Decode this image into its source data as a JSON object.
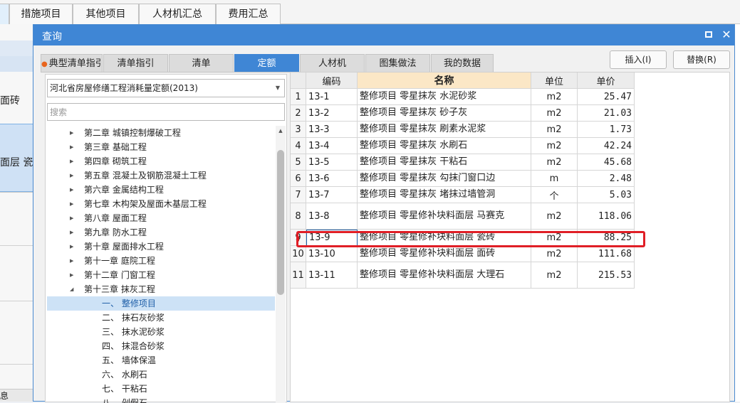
{
  "background": {
    "tabs": [
      {
        "label": ""
      },
      {
        "label": "措施项目"
      },
      {
        "label": "其他项目"
      },
      {
        "label": "人材机汇总"
      },
      {
        "label": "费用汇总"
      }
    ],
    "left_texts": [
      "面砖",
      "面层 瓷"
    ],
    "bottom_tab": "息"
  },
  "dialog": {
    "title": "查询",
    "tabs": [
      {
        "label": "典型清单指引"
      },
      {
        "label": "清单指引"
      },
      {
        "label": "清单"
      },
      {
        "label": "定额"
      },
      {
        "label": "人材机"
      },
      {
        "label": "图集做法"
      },
      {
        "label": "我的数据"
      }
    ],
    "active_tab": "定额",
    "insert_label": "插入(I)",
    "replace_label": "替换(R)",
    "quota_library": "河北省房屋修缮工程消耗量定额(2013)",
    "search_placeholder": "搜索",
    "tree": [
      {
        "label": "第二章 城镇控制爆破工程",
        "expand": "collapsed"
      },
      {
        "label": "第三章 基础工程",
        "expand": "collapsed"
      },
      {
        "label": "第四章 砌筑工程",
        "expand": "collapsed"
      },
      {
        "label": "第五章 混凝土及钢筋混凝土工程",
        "expand": "collapsed"
      },
      {
        "label": "第六章 金属结构工程",
        "expand": "collapsed"
      },
      {
        "label": "第七章 木构架及屋面木基层工程",
        "expand": "collapsed"
      },
      {
        "label": "第八章 屋面工程",
        "expand": "collapsed"
      },
      {
        "label": "第九章 防水工程",
        "expand": "collapsed"
      },
      {
        "label": "第十章 屋面排水工程",
        "expand": "collapsed"
      },
      {
        "label": "第十一章 庭院工程",
        "expand": "collapsed"
      },
      {
        "label": "第十二章 门窗工程",
        "expand": "collapsed"
      },
      {
        "label": "第十三章 抹灰工程",
        "expand": "expanded"
      },
      {
        "label": "一、 整修项目",
        "expand": "none",
        "selected": true
      },
      {
        "label": "二、 抹石灰砂浆",
        "expand": "none"
      },
      {
        "label": "三、 抹水泥砂浆",
        "expand": "none"
      },
      {
        "label": "四、 抹混合砂浆",
        "expand": "none"
      },
      {
        "label": "五、 墙体保温",
        "expand": "none"
      },
      {
        "label": "六、 水刷石",
        "expand": "none"
      },
      {
        "label": "七、 干粘石",
        "expand": "none"
      },
      {
        "label": "八、 剁假石",
        "expand": "none"
      }
    ],
    "grid": {
      "headers": {
        "index": "",
        "code": "编码",
        "name": "名称",
        "unit": "单位",
        "price": "单价"
      },
      "rows": [
        {
          "index": "1",
          "code": "13-1",
          "name": "整修项目 零星抹灰 水泥砂浆",
          "unit": "m2",
          "price": "25.47"
        },
        {
          "index": "2",
          "code": "13-2",
          "name": "整修项目 零星抹灰 砂子灰",
          "unit": "m2",
          "price": "21.03"
        },
        {
          "index": "3",
          "code": "13-3",
          "name": "整修项目 零星抹灰 刷素水泥浆",
          "unit": "m2",
          "price": "1.73"
        },
        {
          "index": "4",
          "code": "13-4",
          "name": "整修项目 零星抹灰 水刷石",
          "unit": "m2",
          "price": "42.24"
        },
        {
          "index": "5",
          "code": "13-5",
          "name": "整修项目 零星抹灰 干粘石",
          "unit": "m2",
          "price": "45.68"
        },
        {
          "index": "6",
          "code": "13-6",
          "name": "整修项目 零星抹灰 勾抹门窗口边",
          "unit": "m",
          "price": "2.48"
        },
        {
          "index": "7",
          "code": "13-7",
          "name": "整修项目 零星抹灰 堵抹过墙管洞",
          "unit": "个",
          "price": "5.03"
        },
        {
          "index": "8",
          "code": "13-8",
          "name": "整修项目 零星修补块料面层 马赛克",
          "unit": "m2",
          "price": "118.06"
        },
        {
          "index": "9",
          "code": "13-9",
          "name": "整修项目 零星修补块料面层 瓷砖",
          "unit": "m2",
          "price": "88.25",
          "current": true
        },
        {
          "index": "10",
          "code": "13-10",
          "name": "整修项目 零星修补块料面层 面砖",
          "unit": "m2",
          "price": "111.68"
        },
        {
          "index": "11",
          "code": "13-11",
          "name": "整修项目 零星修补块料面层 大理石",
          "unit": "m2",
          "price": "215.53"
        }
      ]
    }
  },
  "colors": {
    "accent": "#3f86d5",
    "highlight": "#e01e26",
    "name_header": "#fbe7c6",
    "tree_selected": "#cde2f6"
  }
}
